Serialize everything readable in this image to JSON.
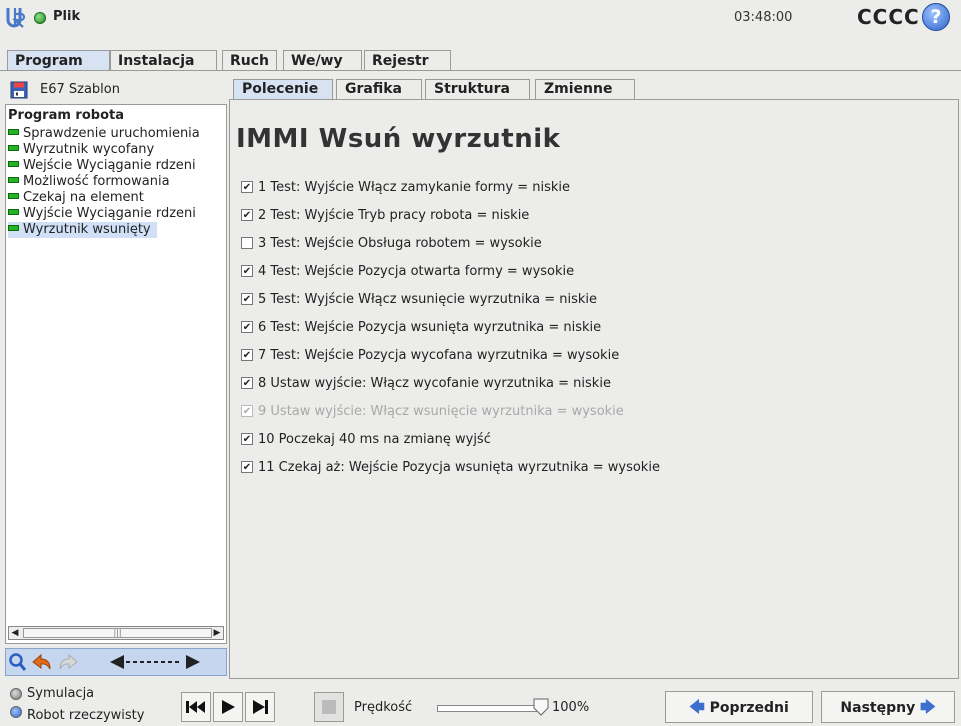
{
  "topbar": {
    "file_menu": "Plik",
    "clock": "03:48:00",
    "robot_name": "CCCC",
    "help": "?"
  },
  "main_tabs": [
    "Program",
    "Instalacja",
    "Ruch",
    "We/wy",
    "Rejestr"
  ],
  "program_file": "E67 Szablon",
  "tree": {
    "root": "Program robota",
    "items": [
      "Sprawdzenie uruchomienia",
      "Wyrzutnik wycofany",
      "Wejście Wyciąganie rdzeni",
      "Możliwość formowania",
      "Czekaj na element",
      "Wyjście Wyciąganie rdzeni",
      "Wyrzutnik wsunięty"
    ],
    "selected_index": 6
  },
  "sub_tabs": [
    "Polecenie",
    "Grafika",
    "Struktura",
    "Zmienne"
  ],
  "command": {
    "title": "IMMI Wsuń wyrzutnik",
    "steps": [
      {
        "text": "1 Test: Wyjście Włącz zamykanie formy = niskie",
        "checked": true,
        "enabled": true
      },
      {
        "text": "2 Test: Wyjście Tryb pracy robota = niskie",
        "checked": true,
        "enabled": true
      },
      {
        "text": "3 Test: Wejście Obsługa robotem = wysokie",
        "checked": false,
        "enabled": true
      },
      {
        "text": "4 Test: Wejście Pozycja otwarta formy = wysokie",
        "checked": true,
        "enabled": true
      },
      {
        "text": "5 Test: Wyjście Włącz wsunięcie wyrzutnika = niskie",
        "checked": true,
        "enabled": true
      },
      {
        "text": "6 Test: Wejście Pozycja wsunięta wyrzutnika = niskie",
        "checked": true,
        "enabled": true
      },
      {
        "text": "7 Test: Wejście Pozycja wycofana wyrzutnika = wysokie",
        "checked": true,
        "enabled": true
      },
      {
        "text": "8 Ustaw wyjście: Włącz wycofanie wyrzutnika = niskie",
        "checked": true,
        "enabled": true
      },
      {
        "text": "9 Ustaw wyjście: Włącz wsunięcie wyrzutnika = wysokie",
        "checked": true,
        "enabled": false
      },
      {
        "text": "10 Poczekaj 40 ms na zmianę wyjść",
        "checked": true,
        "enabled": true
      },
      {
        "text": "11 Czekaj aż: Wejście Pozycja wsunięta wyrzutnika = wysokie",
        "checked": true,
        "enabled": true
      }
    ]
  },
  "bottom": {
    "mode_simulation": "Symulacja",
    "mode_real": "Robot rzeczywisty",
    "speed_label": "Prędkość",
    "speed_value": "100%",
    "speed_fraction": 1.0,
    "prev_label": "Poprzedni",
    "next_label": "Następny"
  },
  "colors": {
    "selection": "#cfe0f7",
    "active_tab": "#d7e3f2",
    "status_green": "#22b422",
    "help_blue": "#2c62c9"
  }
}
